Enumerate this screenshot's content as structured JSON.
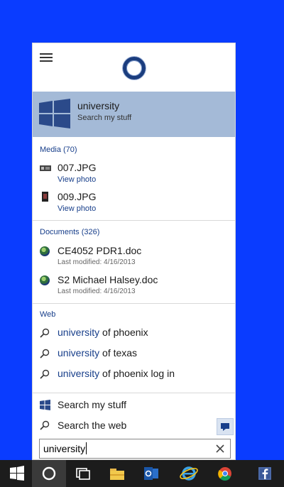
{
  "best_match": {
    "title": "university",
    "subtitle": "Search my stuff"
  },
  "media": {
    "header": "Media (70)",
    "items": [
      {
        "title": "007.JPG",
        "action": "View photo"
      },
      {
        "title": "009.JPG",
        "action": "View photo"
      }
    ]
  },
  "documents": {
    "header": "Documents (326)",
    "items": [
      {
        "title": "CE4052 PDR1.doc",
        "meta": "Last modified: 4/16/2013"
      },
      {
        "title": "S2 Michael Halsey.doc",
        "meta": "Last modified: 4/16/2013"
      }
    ]
  },
  "web": {
    "header": "Web",
    "suggestions": [
      {
        "query": "university",
        "rest": " of phoenix"
      },
      {
        "query": "university",
        "rest": " of texas"
      },
      {
        "query": "university",
        "rest": " of phoenix log in"
      }
    ]
  },
  "bottom": {
    "search_my_stuff": "Search my stuff",
    "search_web": "Search the web"
  },
  "search": {
    "value": "university"
  },
  "colors": {
    "desktop": "#0a3cff",
    "highlight": "#a4bad7",
    "accent": "#173e8a",
    "taskbar": "#1c1c1c"
  },
  "taskbar_icons": [
    "windows-start-icon",
    "cortana-icon",
    "task-view-icon",
    "file-explorer-icon",
    "outlook-icon",
    "internet-explorer-icon",
    "chrome-icon",
    "facebook-icon"
  ]
}
